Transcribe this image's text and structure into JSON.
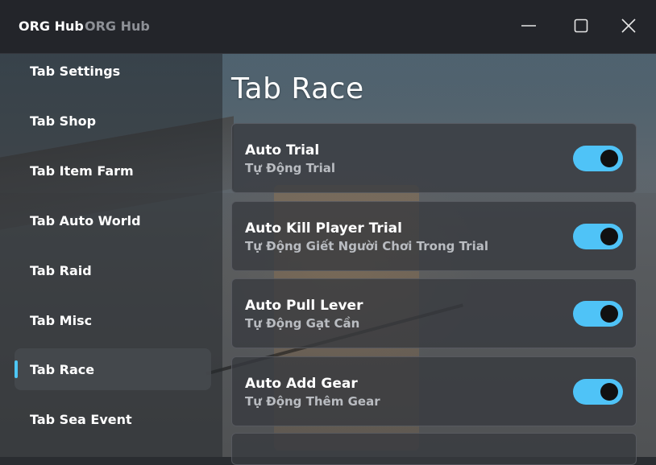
{
  "window": {
    "title": "ORG Hub",
    "subtitle": "ORG Hub",
    "controls": [
      "minimize-icon",
      "maximize-icon",
      "close-icon"
    ]
  },
  "sidebar": {
    "items": [
      {
        "label": "Tab Settings",
        "active": false
      },
      {
        "label": "Tab Shop",
        "active": false
      },
      {
        "label": "Tab Item Farm",
        "active": false
      },
      {
        "label": "Tab Auto World",
        "active": false
      },
      {
        "label": "Tab Raid",
        "active": false
      },
      {
        "label": "Tab Misc",
        "active": false
      },
      {
        "label": "Tab Race",
        "active": true
      },
      {
        "label": "Tab Sea Event",
        "active": false
      }
    ]
  },
  "main": {
    "title": "Tab Race",
    "toggles": [
      {
        "title": "Auto Trial",
        "subtitle": "Tự Động Trial",
        "on": true
      },
      {
        "title": "Auto Kill Player Trial",
        "subtitle": "Tự Động Giết Người Chơi Trong Trial",
        "on": true
      },
      {
        "title": "Auto Pull Lever",
        "subtitle": "Tự Động Gạt Cần",
        "on": true
      },
      {
        "title": "Auto Add Gear",
        "subtitle": "Tự Động Thêm Gear",
        "on": true
      }
    ]
  },
  "colors": {
    "accent": "#4fc3f7",
    "titlebar": "#23252a",
    "card": "#373a3f"
  }
}
